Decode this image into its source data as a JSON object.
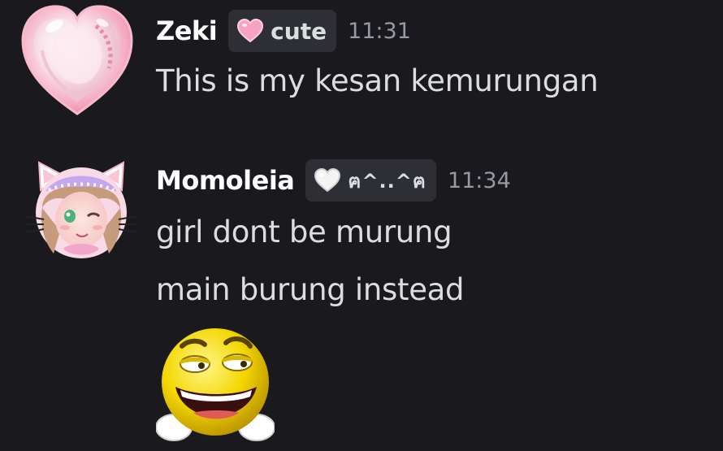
{
  "messages": [
    {
      "username": "Zeki",
      "role_tag": {
        "icon": "pink-heart-icon",
        "label": "cute",
        "color": "#f7a8c4"
      },
      "timestamp": "11:31",
      "lines": [
        "This is my kesan kemurungan"
      ]
    },
    {
      "username": "Momoleia",
      "role_tag": {
        "icon": "white-heart-icon",
        "label": "ฅ^..^ฅ",
        "color": "#f2f2f2"
      },
      "timestamp": "11:34",
      "lines": [
        "girl dont be murung",
        "main burung instead"
      ],
      "attachment": {
        "type": "sticker",
        "icon": "smug-smiley-emoji"
      }
    }
  ],
  "theme": {
    "background": "#1a1a1e",
    "username_color": "#ffffff",
    "text_color": "#dbdee1",
    "timestamp_color": "#949ba4",
    "tag_background": "#2e2f35"
  }
}
